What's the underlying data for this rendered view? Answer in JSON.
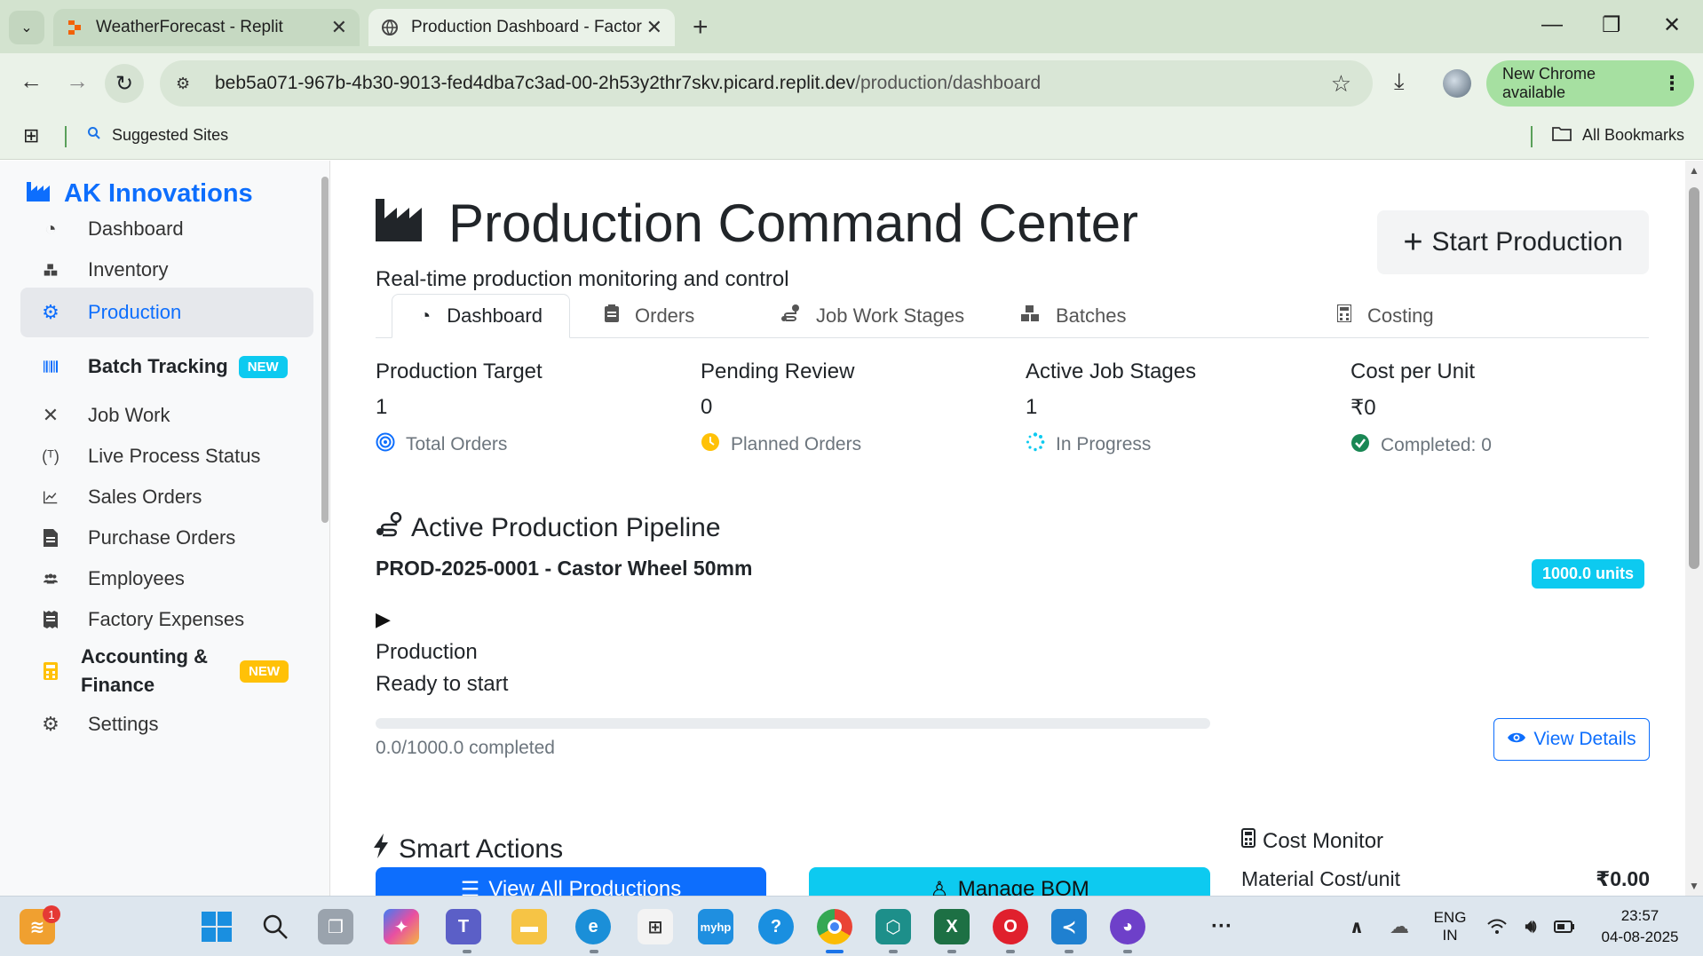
{
  "browser": {
    "tabs": [
      {
        "title": "WeatherForecast - Replit",
        "active": false
      },
      {
        "title": "Production Dashboard - Factory",
        "active": true
      }
    ],
    "url_host": "beb5a071-967b-4b30-9013-fed4dba7c3ad-00-2h53y2thr7skv.picard.replit.dev",
    "url_path": "/production/dashboard",
    "update_label": "New Chrome available",
    "bookmarks": {
      "suggested": "Suggested Sites",
      "all": "All Bookmarks"
    }
  },
  "sidebar": {
    "brand": "AK Innovations",
    "items": [
      {
        "label": "Dashboard",
        "icon": "gauge-icon"
      },
      {
        "label": "Inventory",
        "icon": "boxes-icon"
      },
      {
        "label": "Production",
        "icon": "cogs-icon",
        "active": true
      },
      {
        "label": "Batch Tracking",
        "icon": "barcode-icon",
        "badge": "NEW"
      },
      {
        "label": "Job Work",
        "icon": "tools-icon"
      },
      {
        "label": "Live Process Status",
        "icon": "broadcast-icon"
      },
      {
        "label": "Sales Orders",
        "icon": "chart-line-icon"
      },
      {
        "label": "Purchase Orders",
        "icon": "file-invoice-icon"
      },
      {
        "label": "Employees",
        "icon": "users-icon"
      },
      {
        "label": "Factory Expenses",
        "icon": "receipt-icon"
      },
      {
        "label": "Accounting &",
        "label2": "Finance",
        "icon": "calculator-icon",
        "badge": "NEW"
      },
      {
        "label": "Settings",
        "icon": "gear-icon"
      }
    ]
  },
  "header": {
    "title": "Production Command Center",
    "subtitle": "Real-time production monitoring and control",
    "start_button": "Start Production"
  },
  "tabs": [
    "Dashboard",
    "Orders",
    "Job Work Stages",
    "Batches",
    "Costing"
  ],
  "stats": [
    {
      "label": "Production Target",
      "value": "1",
      "sub": "Total Orders",
      "icon": "bullseye-icon"
    },
    {
      "label": "Pending Review",
      "value": "0",
      "sub": "Planned Orders",
      "icon": "clock-icon"
    },
    {
      "label": "Active Job Stages",
      "value": "1",
      "sub": "In Progress",
      "icon": "spinner-icon"
    },
    {
      "label": "Cost per Unit",
      "value": "₹0",
      "sub": "Completed: 0",
      "icon": "check-circle-icon"
    }
  ],
  "pipeline": {
    "title": "Active Production Pipeline",
    "job": "PROD-2025-0001 - Castor Wheel 50mm",
    "units": "1000.0 units",
    "stage": "Production",
    "status": "Ready to start",
    "progress_fraction": 0,
    "progress_text": "0.0/1000.0 completed",
    "view_button": "View Details"
  },
  "smart_actions": {
    "title": "Smart Actions",
    "buttons": [
      "View All Productions",
      "Manage BOM"
    ]
  },
  "cost_monitor": {
    "title": "Cost Monitor",
    "rows": [
      {
        "label": "Material Cost/unit",
        "value": "₹0.00"
      }
    ]
  },
  "taskbar": {
    "lang": "ENG",
    "region": "IN",
    "time": "23:57",
    "date": "04-08-2025",
    "notification_count": "1"
  },
  "colors": {
    "primary": "#0d6efd",
    "info": "#0dcaf0",
    "warning": "#ffc107",
    "success": "#198754"
  }
}
